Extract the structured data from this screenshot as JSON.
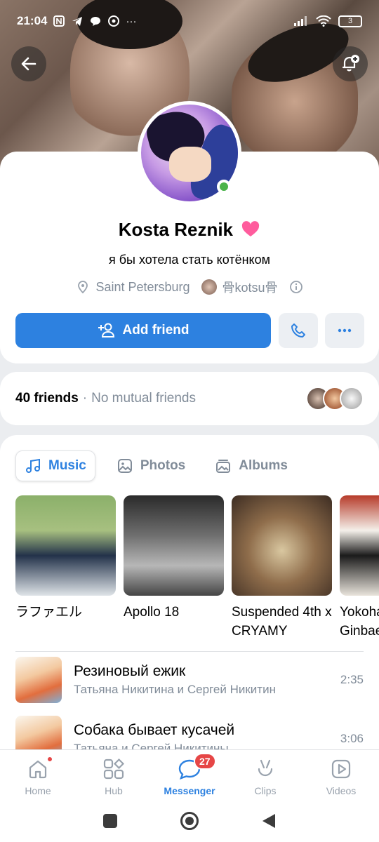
{
  "status_bar": {
    "time": "21:04",
    "battery": "3"
  },
  "profile": {
    "name": "Kosta Reznik",
    "status": "я бы хотела стать котёнком",
    "location": "Saint Petersburg",
    "extra": "骨kotsu骨"
  },
  "actions": {
    "add_friend_label": "Add friend"
  },
  "friends": {
    "count_label": "40 friends",
    "separator": "·",
    "mutual_label": "No mutual friends"
  },
  "tabs": [
    {
      "label": "Music",
      "icon": "music-note-icon",
      "active": true
    },
    {
      "label": "Photos",
      "icon": "image-icon",
      "active": false
    },
    {
      "label": "Albums",
      "icon": "albums-icon",
      "active": false
    }
  ],
  "albums": [
    {
      "title": "ラファエル"
    },
    {
      "title": "Apollo 18"
    },
    {
      "title": "Suspended 4th x CRYAMY"
    },
    {
      "title": "Yokohama Ginbae"
    }
  ],
  "tracks": [
    {
      "title": "Резиновый ежик",
      "artist": "Татьяна Никитина и Сергей Никитин",
      "duration": "2:35"
    },
    {
      "title": "Собака бывает кусачей",
      "artist": "Татьяна и Сергей Никитины",
      "duration": "3:06"
    }
  ],
  "bottom_nav": [
    {
      "label": "Home",
      "icon": "home-icon"
    },
    {
      "label": "Hub",
      "icon": "grid-icon"
    },
    {
      "label": "Messenger",
      "icon": "chat-bubble-icon",
      "badge": "27",
      "active": true
    },
    {
      "label": "Clips",
      "icon": "clips-icon"
    },
    {
      "label": "Videos",
      "icon": "video-play-icon"
    }
  ],
  "colors": {
    "accent": "#2d81e0",
    "muted": "#818c99",
    "badge": "#e64646",
    "online": "#4bb34b",
    "heart": "#ff5c9d"
  }
}
